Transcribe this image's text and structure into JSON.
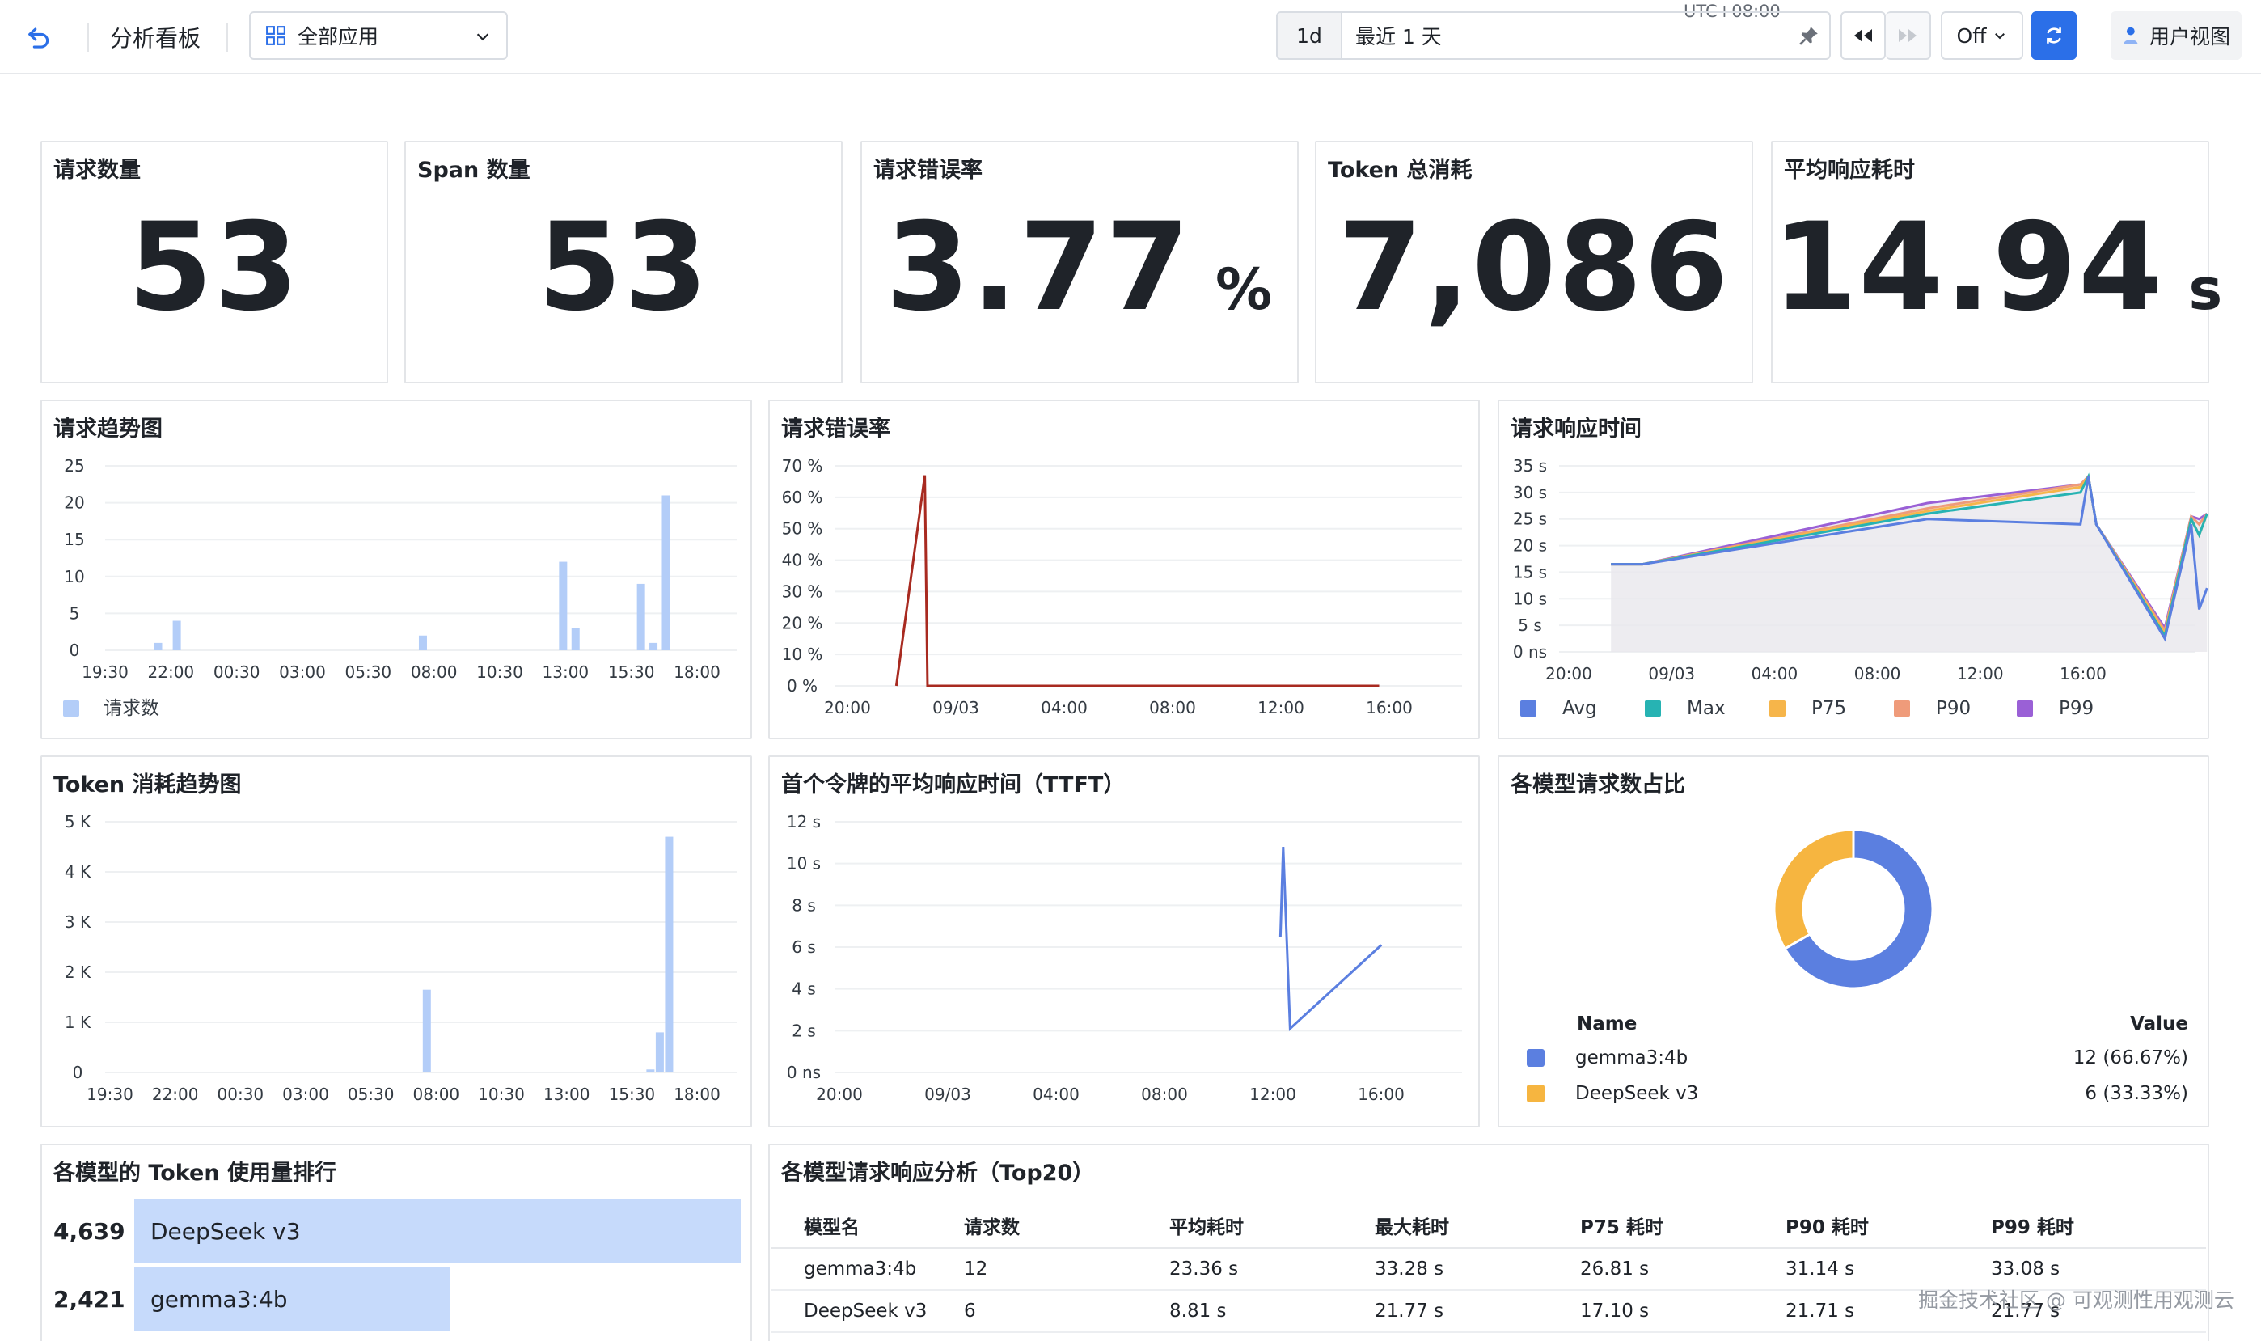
{
  "topbar": {
    "title": "分析看板",
    "app_select": "全部应用",
    "timezone": "UTC+08:00",
    "range_short": "1d",
    "range_label": "最近 1 天",
    "refresh_interval": "Off",
    "user_view": "用户视图"
  },
  "stats": [
    {
      "title": "请求数量",
      "value": "53",
      "unit": ""
    },
    {
      "title": "Span 数量",
      "value": "53",
      "unit": ""
    },
    {
      "title": "请求错误率",
      "value": "3.77",
      "unit": "%"
    },
    {
      "title": "Token 总消耗",
      "value": "7,086",
      "unit": ""
    },
    {
      "title": "平均响应耗时",
      "value": "14.94",
      "unit": "s"
    }
  ],
  "panels": {
    "req_trend": "请求趋势图",
    "err_rate": "请求错误率",
    "resp_time": "请求响应时间",
    "token_trend": "Token 消耗趋势图",
    "ttft": "首个令牌的平均响应时间（TTFT）",
    "model_share": "各模型请求数占比",
    "token_rank": "各模型的 Token 使用量排行",
    "analysis": "各模型请求响应分析（Top20）"
  },
  "chart_data": [
    {
      "type": "bar",
      "title": "请求趋势图",
      "x_ticks": [
        "19:30",
        "22:00",
        "00:30",
        "03:00",
        "05:30",
        "08:00",
        "10:30",
        "13:00",
        "15:30",
        "18:00"
      ],
      "y_ticks": [
        "0",
        "5",
        "10",
        "15",
        "20",
        "25"
      ],
      "ylim": [
        0,
        25
      ],
      "series": [
        {
          "name": "请求数",
          "color": "#b3cdf8",
          "points": [
            [
              1.7,
              1
            ],
            [
              2.3,
              4
            ],
            [
              10.2,
              2
            ],
            [
              14.7,
              12
            ],
            [
              15.1,
              3
            ],
            [
              17.2,
              9
            ],
            [
              17.6,
              1
            ],
            [
              18.0,
              21
            ]
          ]
        }
      ],
      "x_domain_hours": [
        19.5,
        42.5
      ],
      "legend": "bottom-left"
    },
    {
      "type": "line",
      "title": "请求错误率",
      "x_ticks": [
        "20:00",
        "09/03",
        "04:00",
        "08:00",
        "12:00",
        "16:00"
      ],
      "y_ticks": [
        "0 %",
        "10 %",
        "20 %",
        "30 %",
        "40 %",
        "50 %",
        "60 %",
        "70 %"
      ],
      "ylim": [
        0,
        70
      ],
      "series": [
        {
          "color": "#a82a20",
          "points": [
            [
              1.8,
              0
            ],
            [
              2.85,
              67
            ],
            [
              2.95,
              0
            ],
            [
              4,
              0
            ],
            [
              8,
              0
            ],
            [
              12,
              0
            ],
            [
              16,
              0
            ],
            [
              19.6,
              0
            ]
          ]
        }
      ]
    },
    {
      "type": "area",
      "title": "请求响应时间",
      "x_ticks": [
        "20:00",
        "09/03",
        "04:00",
        "08:00",
        "12:00",
        "16:00"
      ],
      "y_ticks": [
        "0 ns",
        "5 s",
        "10 s",
        "15 s",
        "20 s",
        "25 s",
        "30 s",
        "35 s"
      ],
      "ylim": [
        0,
        35
      ],
      "series": [
        {
          "name": "Avg",
          "color": "#5b7fe0",
          "points": [
            [
              0.8,
              16.5
            ],
            [
              1.4,
              16.5
            ],
            [
              6.8,
              25
            ],
            [
              9.7,
              24
            ],
            [
              9.85,
              33
            ],
            [
              10,
              24
            ],
            [
              11.3,
              2.5
            ],
            [
              11.8,
              24
            ],
            [
              11.95,
              8
            ],
            [
              12.1,
              12
            ]
          ]
        },
        {
          "name": "Max",
          "color": "#27b3b3",
          "points": [
            [
              0.8,
              16.5
            ],
            [
              1.4,
              16.5
            ],
            [
              6.8,
              26
            ],
            [
              9.7,
              30
            ],
            [
              9.85,
              33
            ],
            [
              10,
              24
            ],
            [
              11.3,
              3
            ],
            [
              11.8,
              25
            ],
            [
              11.95,
              22
            ],
            [
              12.1,
              26
            ]
          ]
        },
        {
          "name": "P75",
          "color": "#f6b54a",
          "points": [
            [
              0.8,
              16.5
            ],
            [
              1.4,
              16.5
            ],
            [
              6.8,
              26.5
            ],
            [
              9.7,
              31
            ],
            [
              9.85,
              33
            ],
            [
              10,
              24
            ],
            [
              11.3,
              3.5
            ],
            [
              11.8,
              25
            ],
            [
              11.95,
              22
            ],
            [
              12.1,
              26
            ]
          ]
        },
        {
          "name": "P90",
          "color": "#ef9b7a",
          "points": [
            [
              0.8,
              16.5
            ],
            [
              1.4,
              16.5
            ],
            [
              6.8,
              27
            ],
            [
              9.7,
              31.5
            ],
            [
              9.85,
              33
            ],
            [
              10,
              24
            ],
            [
              11.3,
              4
            ],
            [
              11.8,
              25.5
            ],
            [
              11.95,
              24
            ],
            [
              12.1,
              26
            ]
          ]
        },
        {
          "name": "P99",
          "color": "#9a60d6",
          "points": [
            [
              0.8,
              16.5
            ],
            [
              1.4,
              16.5
            ],
            [
              6.8,
              28
            ],
            [
              9.7,
              31.5
            ],
            [
              9.85,
              33
            ],
            [
              10,
              24
            ],
            [
              11.3,
              4.5
            ],
            [
              11.8,
              25.5
            ],
            [
              11.95,
              25
            ],
            [
              12.1,
              26
            ]
          ]
        }
      ],
      "legend": "bottom"
    },
    {
      "type": "bar",
      "title": "Token 消耗趋势图",
      "x_ticks": [
        "19:30",
        "22:00",
        "00:30",
        "03:00",
        "05:30",
        "08:00",
        "10:30",
        "13:00",
        "15:30",
        "18:00"
      ],
      "y_ticks": [
        "0",
        "1 K",
        "2 K",
        "3 K",
        "4 K",
        "5 K"
      ],
      "ylim": [
        0,
        5000
      ],
      "series": [
        {
          "color": "#b3cdf8",
          "points": [
            [
              10.2,
              1650
            ],
            [
              17.4,
              60
            ],
            [
              17.7,
              800
            ],
            [
              18.0,
              4700
            ]
          ]
        }
      ]
    },
    {
      "type": "line",
      "title": "首个令牌的平均响应时间（TTFT）",
      "x_ticks": [
        "20:00",
        "09/03",
        "04:00",
        "08:00",
        "12:00",
        "16:00"
      ],
      "y_ticks": [
        "0 ns",
        "2 s",
        "4 s",
        "6 s",
        "8 s",
        "10 s",
        "12 s"
      ],
      "ylim": [
        0,
        12
      ],
      "series": [
        {
          "color": "#5b7fe0",
          "points": [
            [
              15.95,
              6.5
            ],
            [
              16.05,
              10.8
            ],
            [
              16.3,
              2.1
            ],
            [
              19.6,
              6.1
            ]
          ]
        }
      ]
    },
    {
      "type": "pie",
      "title": "各模型请求数占比",
      "columns": [
        "Name",
        "Value"
      ],
      "slices": [
        {
          "name": "gemma3:4b",
          "value": 12,
          "label": "12 (66.67%)",
          "color": "#5b7fe0"
        },
        {
          "name": "DeepSeek v3",
          "value": 6,
          "label": "6 (33.33%)",
          "color": "#f6b540"
        }
      ]
    },
    {
      "type": "bar",
      "title": "各模型的 Token 使用量排行",
      "categories": [
        "DeepSeek v3",
        "gemma3:4b"
      ],
      "values": [
        4639,
        2421
      ],
      "labels": [
        "4,639",
        "2,421"
      ]
    }
  ],
  "analysis_table": {
    "columns": [
      "模型名",
      "请求数",
      "平均耗时",
      "最大耗时",
      "P75 耗时",
      "P90 耗时",
      "P99 耗时"
    ],
    "rows": [
      [
        "gemma3:4b",
        "12",
        "23.36 s",
        "33.28 s",
        "26.81 s",
        "31.14 s",
        "33.08 s"
      ],
      [
        "DeepSeek v3",
        "6",
        "8.81 s",
        "21.77 s",
        "17.10 s",
        "21.71 s",
        "21.77 s"
      ]
    ]
  },
  "watermark": "掘金技术社区 @ 可观测性用观测云"
}
